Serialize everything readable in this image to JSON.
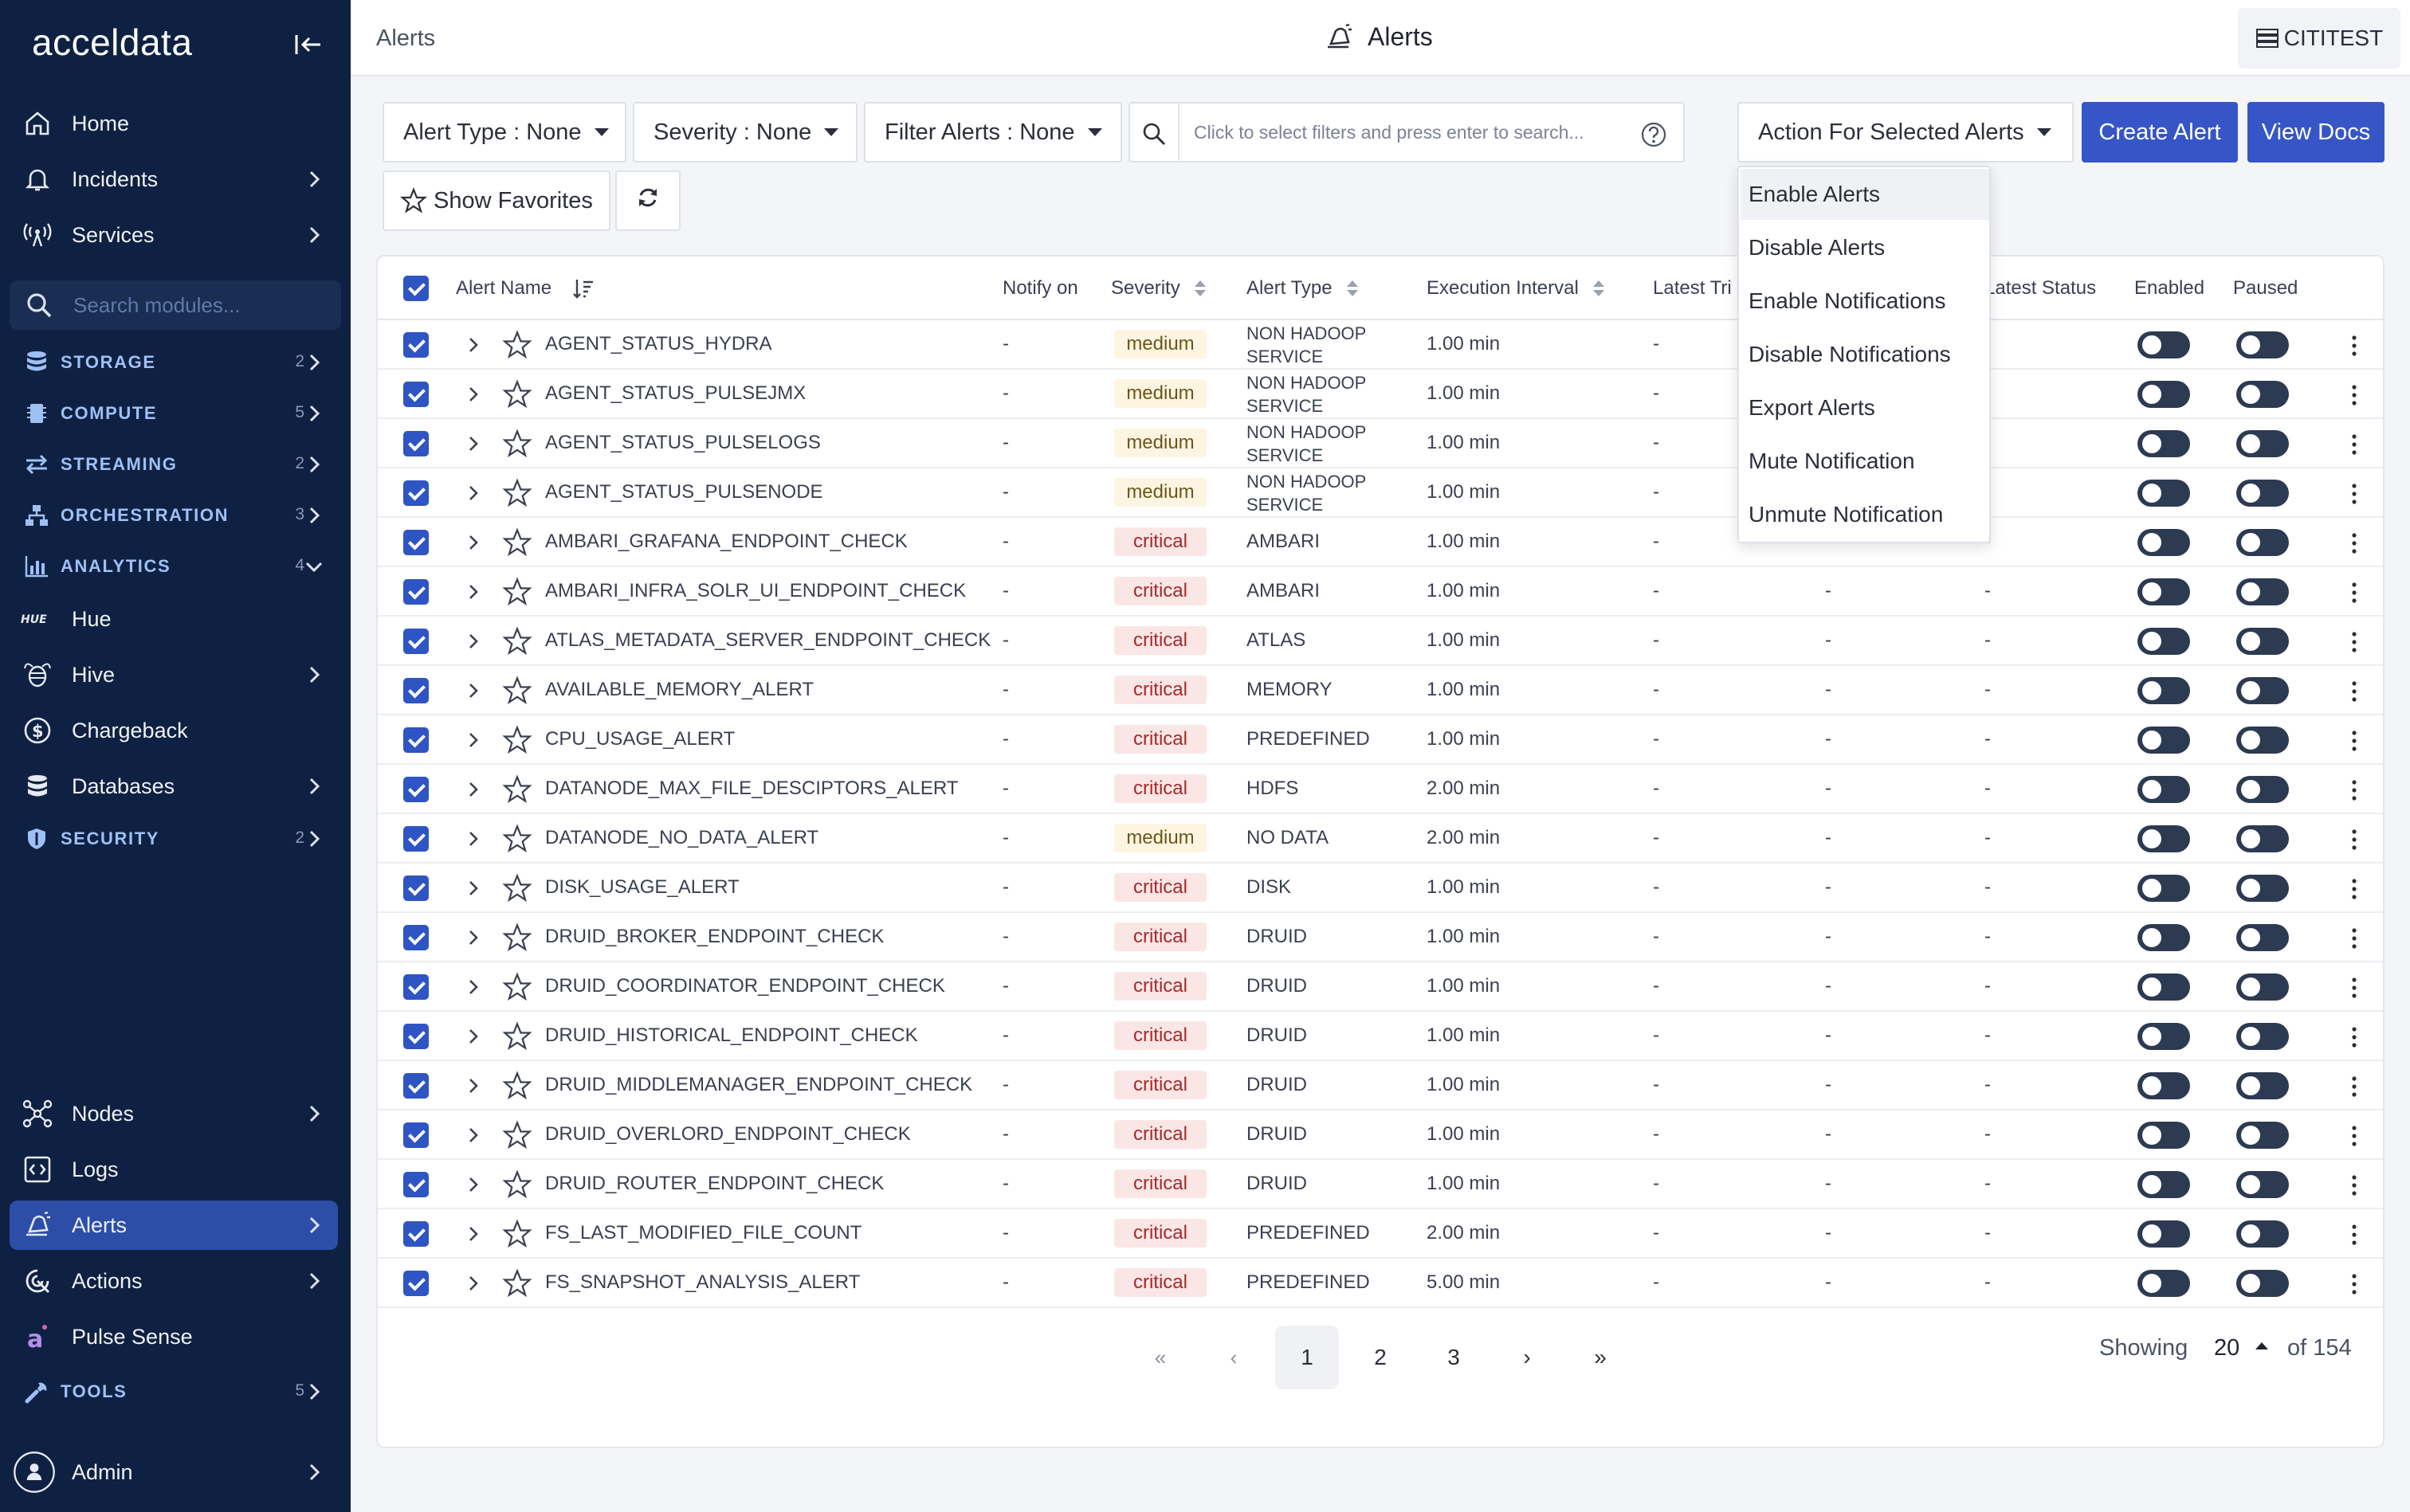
{
  "sidebar": {
    "logo": "acceldata",
    "search_placeholder": "Search modules...",
    "items_top": [
      {
        "label": "Home",
        "icon": "home-icon"
      },
      {
        "label": "Incidents",
        "icon": "bell-icon"
      },
      {
        "label": "Services",
        "icon": "antenna-icon"
      }
    ],
    "groups": [
      {
        "label": "STORAGE",
        "count": "2"
      },
      {
        "label": "COMPUTE",
        "count": "5"
      },
      {
        "label": "STREAMING",
        "count": "2"
      },
      {
        "label": "ORCHESTRATION",
        "count": "3"
      },
      {
        "label": "ANALYTICS",
        "count": "4"
      }
    ],
    "analytics_items": [
      {
        "label": "Hue"
      },
      {
        "label": "Hive"
      },
      {
        "label": "Chargeback"
      },
      {
        "label": "Databases"
      }
    ],
    "security": {
      "label": "SECURITY",
      "count": "2"
    },
    "items_bottom": [
      {
        "label": "Nodes"
      },
      {
        "label": "Logs"
      },
      {
        "label": "Alerts"
      },
      {
        "label": "Actions"
      },
      {
        "label": "Pulse Sense"
      }
    ],
    "tools": {
      "label": "TOOLS",
      "count": "5"
    },
    "user": {
      "label": "Admin"
    }
  },
  "header": {
    "breadcrumb": "Alerts",
    "title": "Alerts",
    "tenant": "CITITEST"
  },
  "toolbar": {
    "alert_type": "Alert Type : None",
    "severity": "Severity : None",
    "filter_alerts": "Filter Alerts : None",
    "search_placeholder": "Click to select filters and press enter to search...",
    "action_selected": "Action For Selected Alerts",
    "create_alert": "Create Alert",
    "view_docs": "View Docs",
    "show_favorites": "Show Favorites"
  },
  "action_menu": {
    "items": [
      "Enable Alerts",
      "Disable Alerts",
      "Enable Notifications",
      "Disable Notifications",
      "Export Alerts",
      "Mute Notification",
      "Unmute Notification"
    ]
  },
  "table": {
    "columns": {
      "alert_name": "Alert Name",
      "notify_on": "Notify on",
      "severity": "Severity",
      "alert_type": "Alert Type",
      "execution_interval": "Execution Interval",
      "latest_trigger": "Latest Tri",
      "latest_status": "Latest Status",
      "enabled": "Enabled",
      "paused": "Paused"
    },
    "rows": [
      {
        "name": "AGENT_STATUS_HYDRA",
        "notify": "-",
        "severity": "medium",
        "type": "NON HADOOP SERVICE",
        "interval": "1.00 min",
        "trig": "-",
        "c2": "",
        "status": "-"
      },
      {
        "name": "AGENT_STATUS_PULSEJMX",
        "notify": "-",
        "severity": "medium",
        "type": "NON HADOOP SERVICE",
        "interval": "1.00 min",
        "trig": "-",
        "c2": "",
        "status": "-"
      },
      {
        "name": "AGENT_STATUS_PULSELOGS",
        "notify": "-",
        "severity": "medium",
        "type": "NON HADOOP SERVICE",
        "interval": "1.00 min",
        "trig": "-",
        "c2": "",
        "status": "-"
      },
      {
        "name": "AGENT_STATUS_PULSENODE",
        "notify": "-",
        "severity": "medium",
        "type": "NON HADOOP SERVICE",
        "interval": "1.00 min",
        "trig": "-",
        "c2": "",
        "status": "-"
      },
      {
        "name": "AMBARI_GRAFANA_ENDPOINT_CHECK",
        "notify": "-",
        "severity": "critical",
        "type": "AMBARI",
        "interval": "1.00 min",
        "trig": "-",
        "c2": "",
        "status": "-"
      },
      {
        "name": "AMBARI_INFRA_SOLR_UI_ENDPOINT_CHECK",
        "notify": "-",
        "severity": "critical",
        "type": "AMBARI",
        "interval": "1.00 min",
        "trig": "-",
        "c2": "-",
        "status": "-"
      },
      {
        "name": "ATLAS_METADATA_SERVER_ENDPOINT_CHECK",
        "notify": "-",
        "severity": "critical",
        "type": "ATLAS",
        "interval": "1.00 min",
        "trig": "-",
        "c2": "-",
        "status": "-"
      },
      {
        "name": "AVAILABLE_MEMORY_ALERT",
        "notify": "-",
        "severity": "critical",
        "type": "MEMORY",
        "interval": "1.00 min",
        "trig": "-",
        "c2": "-",
        "status": "-"
      },
      {
        "name": "CPU_USAGE_ALERT",
        "notify": "-",
        "severity": "critical",
        "type": "PREDEFINED",
        "interval": "1.00 min",
        "trig": "-",
        "c2": "-",
        "status": "-"
      },
      {
        "name": "DATANODE_MAX_FILE_DESCIPTORS_ALERT",
        "notify": "-",
        "severity": "critical",
        "type": "HDFS",
        "interval": "2.00 min",
        "trig": "-",
        "c2": "-",
        "status": "-"
      },
      {
        "name": "DATANODE_NO_DATA_ALERT",
        "notify": "-",
        "severity": "medium",
        "type": "NO DATA",
        "interval": "2.00 min",
        "trig": "-",
        "c2": "-",
        "status": "-"
      },
      {
        "name": "DISK_USAGE_ALERT",
        "notify": "-",
        "severity": "critical",
        "type": "DISK",
        "interval": "1.00 min",
        "trig": "-",
        "c2": "-",
        "status": "-"
      },
      {
        "name": "DRUID_BROKER_ENDPOINT_CHECK",
        "notify": "-",
        "severity": "critical",
        "type": "DRUID",
        "interval": "1.00 min",
        "trig": "-",
        "c2": "-",
        "status": "-"
      },
      {
        "name": "DRUID_COORDINATOR_ENDPOINT_CHECK",
        "notify": "-",
        "severity": "critical",
        "type": "DRUID",
        "interval": "1.00 min",
        "trig": "-",
        "c2": "-",
        "status": "-"
      },
      {
        "name": "DRUID_HISTORICAL_ENDPOINT_CHECK",
        "notify": "-",
        "severity": "critical",
        "type": "DRUID",
        "interval": "1.00 min",
        "trig": "-",
        "c2": "-",
        "status": "-"
      },
      {
        "name": "DRUID_MIDDLEMANAGER_ENDPOINT_CHECK",
        "notify": "-",
        "severity": "critical",
        "type": "DRUID",
        "interval": "1.00 min",
        "trig": "-",
        "c2": "-",
        "status": "-"
      },
      {
        "name": "DRUID_OVERLORD_ENDPOINT_CHECK",
        "notify": "-",
        "severity": "critical",
        "type": "DRUID",
        "interval": "1.00 min",
        "trig": "-",
        "c2": "-",
        "status": "-"
      },
      {
        "name": "DRUID_ROUTER_ENDPOINT_CHECK",
        "notify": "-",
        "severity": "critical",
        "type": "DRUID",
        "interval": "1.00 min",
        "trig": "-",
        "c2": "-",
        "status": "-"
      },
      {
        "name": "FS_LAST_MODIFIED_FILE_COUNT",
        "notify": "-",
        "severity": "critical",
        "type": "PREDEFINED",
        "interval": "2.00 min",
        "trig": "-",
        "c2": "-",
        "status": "-"
      },
      {
        "name": "FS_SNAPSHOT_ANALYSIS_ALERT",
        "notify": "-",
        "severity": "critical",
        "type": "PREDEFINED",
        "interval": "5.00 min",
        "trig": "-",
        "c2": "-",
        "status": "-"
      }
    ]
  },
  "pagination": {
    "first": "«",
    "prev": "‹",
    "pages": [
      "1",
      "2",
      "3"
    ],
    "next": "›",
    "last": "»",
    "showing_label": "Showing",
    "page_size": "20",
    "total": "of 154"
  },
  "colors": {
    "sidebar_bg": "#0f2142",
    "accent": "#3656c7",
    "active_nav": "#2c4ea8"
  }
}
